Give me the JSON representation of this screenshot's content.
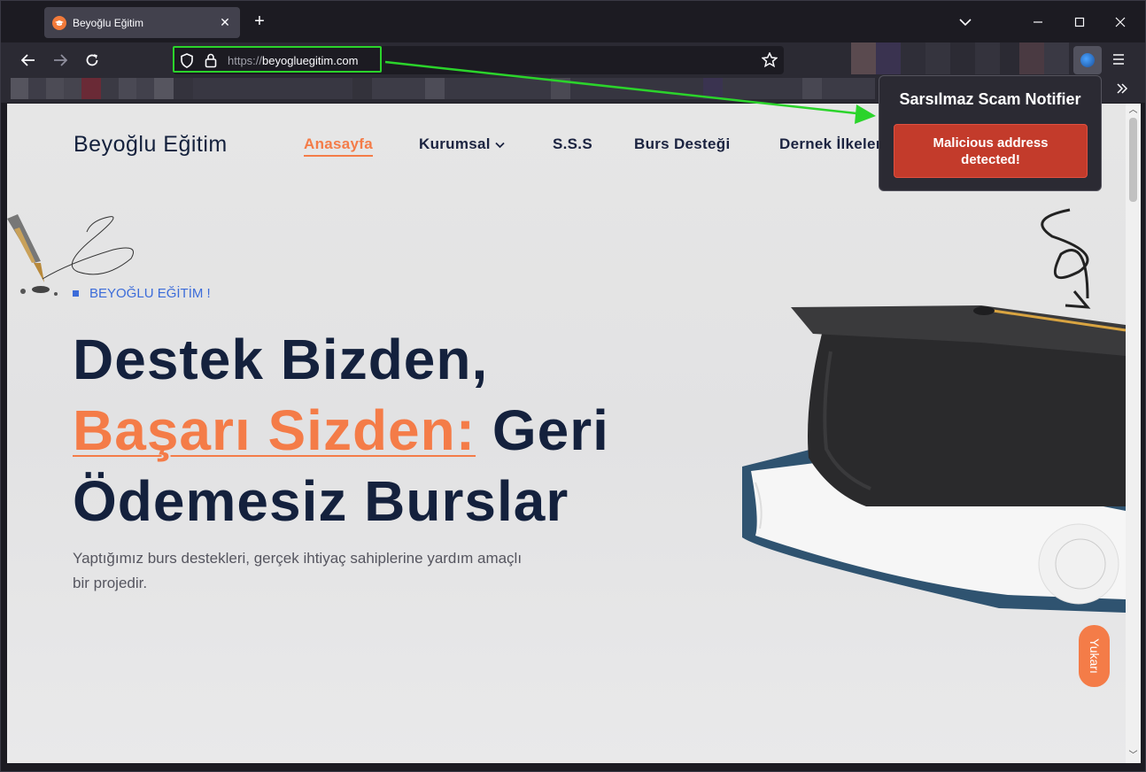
{
  "browser": {
    "tab_title": "Beyoğlu Eğitim",
    "url_protocol": "https://",
    "url_domain": "beyogluegitim.com"
  },
  "site": {
    "logo": "Beyoğlu Eğitim",
    "nav": [
      {
        "label": "Anasayfa",
        "active": true
      },
      {
        "label": "Kurumsal",
        "dropdown": true
      },
      {
        "label": "S.S.S"
      },
      {
        "label": "Burs Desteği"
      },
      {
        "label": "Dernek İlkeleri"
      }
    ],
    "kicker": "BEYOĞLU EĞİTİM !",
    "headline_line1": "Destek Bizden,",
    "headline_accent": "Başarı Sizden:",
    "headline_line2_rest": " Geri",
    "headline_line3": "Ödemesiz Burslar",
    "subtitle": "Yaptığımız burs destekleri, gerçek ihtiyaç sahiplerine yardım amaçlı bir projedir.",
    "back_to_top": "Yukarı"
  },
  "extension_popup": {
    "title": "Sarsılmaz Scam Notifier",
    "alert": "Malicious address detected!"
  },
  "colors": {
    "accent": "#f47c48",
    "navy": "#14213d",
    "alert_red": "#c33b2b",
    "highlight_green": "#2bd42b"
  }
}
